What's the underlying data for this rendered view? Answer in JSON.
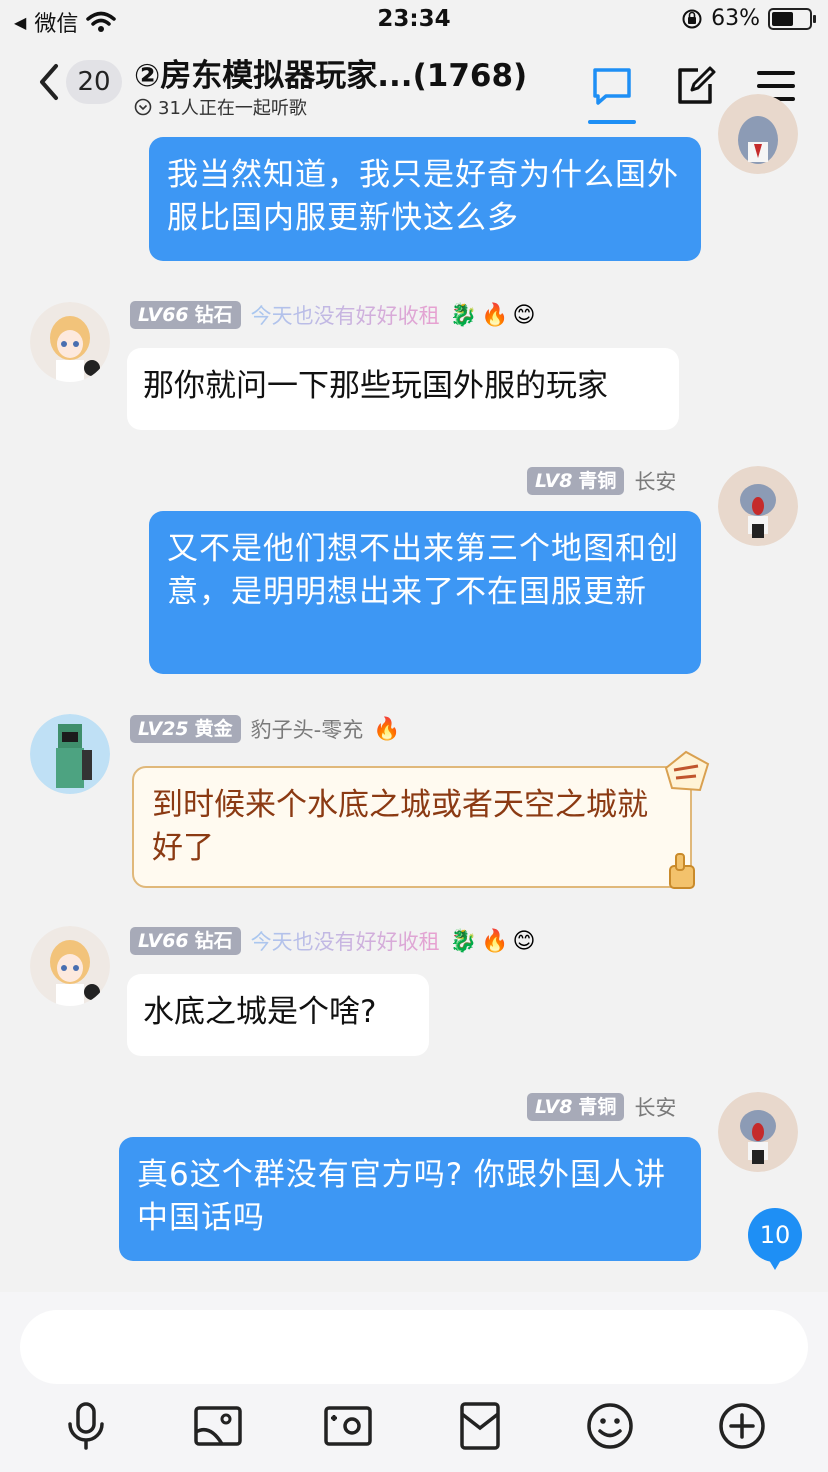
{
  "status_bar": {
    "carrier": "微信",
    "time": "23:34",
    "battery": "63%",
    "battery_level": 0.63
  },
  "header": {
    "unread_count": "20",
    "title": "②房东模拟器玩家...(1768)",
    "subtitle": "31人正在一起听歌"
  },
  "messages": [
    {
      "side": "right",
      "text": "我当然知道，我只是好奇为什么国外服比国内服更新快这么多"
    },
    {
      "side": "left",
      "level": "LV66",
      "rank": "钻石",
      "nickname": "今天也没有好好收租",
      "text": "那你就问一下那些玩国外服的玩家"
    },
    {
      "side": "right",
      "level": "LV8",
      "rank": "青铜",
      "nickname": "长安",
      "text": "又不是他们想不出来第三个地图和创意，是明明想出来了不在国服更新"
    },
    {
      "side": "left",
      "level": "LV25",
      "rank": "黄金",
      "nickname": "豹子头-零充",
      "text": "到时候来个水底之城或者天空之城就好了"
    },
    {
      "side": "left",
      "level": "LV66",
      "rank": "钻石",
      "nickname": "今天也没有好好收租",
      "text": "水底之城是个啥?"
    },
    {
      "side": "right",
      "level": "LV8",
      "rank": "青铜",
      "nickname": "长安",
      "text": "真6这个群没有官方吗? 你跟外国人讲中国话吗"
    }
  ],
  "new_message_badge": "10",
  "toolbar": [
    "microphone-icon",
    "image-icon",
    "camera-icon",
    "red-packet-icon",
    "emoji-icon",
    "plus-icon"
  ],
  "colors": {
    "accent": "#1e8ff5",
    "self_bubble": "#3d97f4",
    "background": "#f2f2f2"
  }
}
